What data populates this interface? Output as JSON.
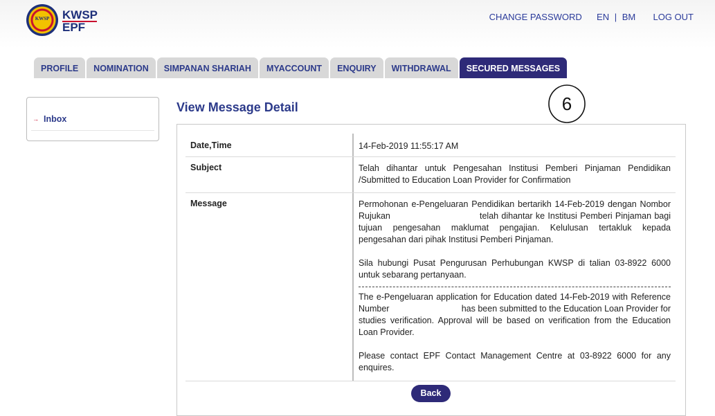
{
  "brand": {
    "name1": "KWSP",
    "name2": "EPF",
    "seal": "KWSP"
  },
  "top_links": {
    "change_password": "CHANGE PASSWORD",
    "lang_en": "EN",
    "lang_sep": "|",
    "lang_bm": "BM",
    "logout": "LOG OUT"
  },
  "tabs": [
    {
      "label": "PROFILE",
      "active": false
    },
    {
      "label": "NOMINATION",
      "active": false
    },
    {
      "label": "SIMPANAN SHARIAH",
      "active": false
    },
    {
      "label": "MYACCOUNT",
      "active": false
    },
    {
      "label": "ENQUIRY",
      "active": false
    },
    {
      "label": "WITHDRAWAL",
      "active": false
    },
    {
      "label": "SECURED MESSAGES",
      "active": true
    }
  ],
  "sidebar": {
    "inbox": "Inbox"
  },
  "page_title": "View Message Detail",
  "message": {
    "date_label": "Date,Time",
    "date_value": "14-Feb-2019 11:55:17 AM",
    "subject_label": "Subject",
    "subject_value": "Telah dihantar untuk Pengesahan Institusi Pemberi Pinjaman Pendidikan /Submitted to Education Loan Provider for Confirmation",
    "message_label": "Message",
    "bm_para1": "Permohonan e-Pengeluaran Pendidikan bertarikh 14-Feb-2019 dengan Nombor Rujukan                              telah dihantar ke Institusi Pemberi Pinjaman bagi tujuan pengesahan maklumat pengajian. Kelulusan tertakluk kepada pengesahan dari pihak Institusi Pemberi Pinjaman.",
    "bm_para2": "Sila hubungi Pusat Pengurusan Perhubungan KWSP di talian 03-8922 6000 untuk sebarang pertanyaan.",
    "en_para1": "The e-Pengeluaran application for Education dated 14-Feb-2019 with Reference Number                              has been submitted to the Education Loan Provider for studies verification. Approval will be based on verification from the Education Loan Provider.",
    "en_para2": "Please contact EPF Contact Management Centre at 03-8922 6000 for any enquires."
  },
  "back_button": "Back",
  "annotation_text": "6",
  "colors": {
    "navy": "#2e2a78",
    "link": "#2a3a9a",
    "red": "#c8102e"
  }
}
